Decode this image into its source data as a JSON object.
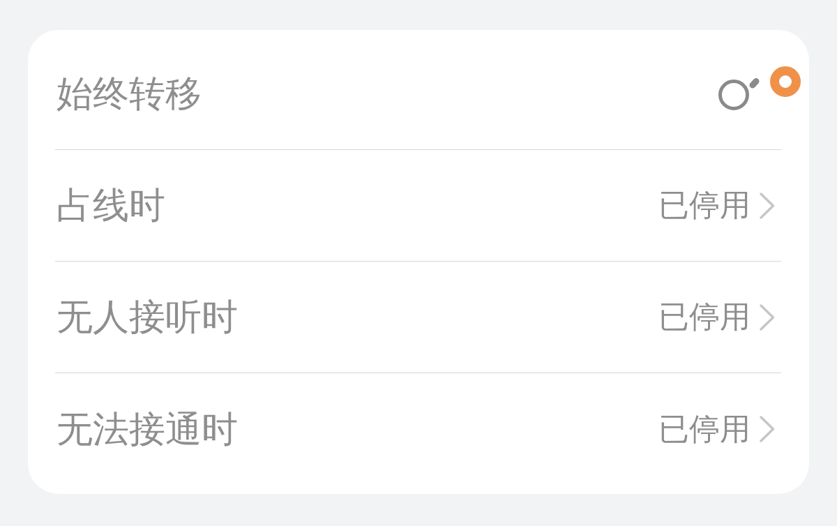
{
  "rows": [
    {
      "kind": "switch",
      "label": "始终转移"
    },
    {
      "kind": "link",
      "label": "占线时",
      "value": "已停用"
    },
    {
      "kind": "link",
      "label": "无人接听时",
      "value": "已停用"
    },
    {
      "kind": "link",
      "label": "无法接通时",
      "value": "已停用"
    }
  ]
}
